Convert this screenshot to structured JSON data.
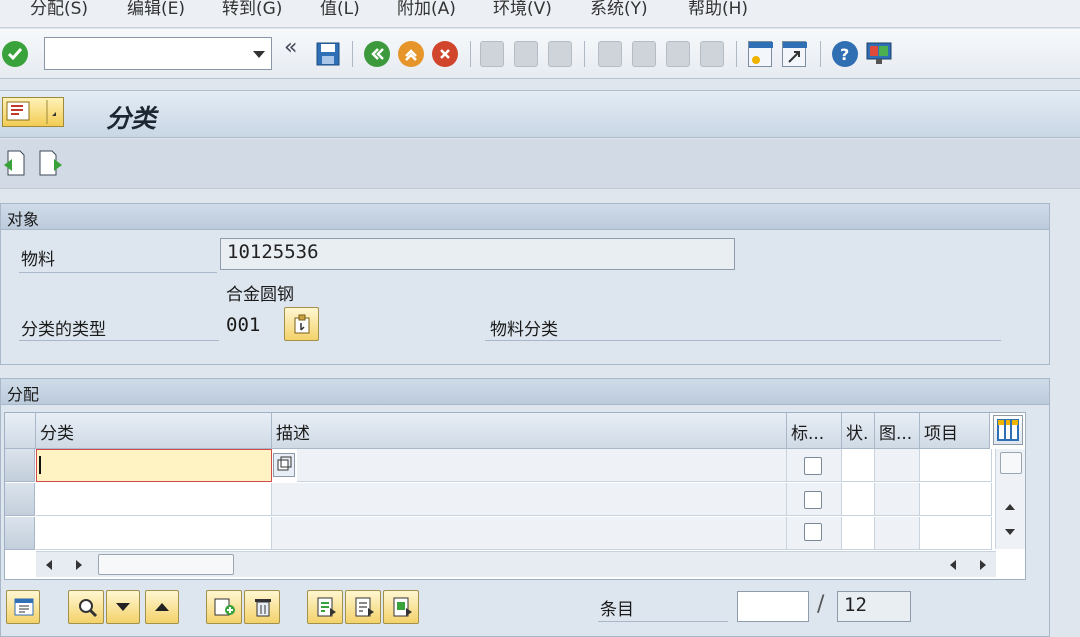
{
  "menu": {
    "items": [
      {
        "label": "分配(S)"
      },
      {
        "label": "编辑(E)"
      },
      {
        "label": "转到(G)"
      },
      {
        "label": "值(L)"
      },
      {
        "label": "附加(A)"
      },
      {
        "label": "环境(V)"
      },
      {
        "label": "系统(Y)"
      },
      {
        "label": "帮助(H)"
      }
    ]
  },
  "toolbar": {
    "command_value": "",
    "back_glyph": "«"
  },
  "title": {
    "text": "分类"
  },
  "object_group": {
    "title": "对象",
    "material_label": "物料",
    "material_value": "10125536",
    "material_desc": "合金圆钢",
    "class_type_label": "分类的类型",
    "class_type_value": "001",
    "class_type_desc": "物料分类"
  },
  "assignment_group": {
    "title": "分配",
    "columns": [
      "分类",
      "描述",
      "标...",
      "状.",
      "图...",
      "项目"
    ],
    "rows": [
      {
        "class": "",
        "desc": "",
        "std": false
      },
      {
        "class": "",
        "desc": "",
        "std": false
      },
      {
        "class": "",
        "desc": "",
        "std": false
      }
    ]
  },
  "footer": {
    "entries_label": "条目",
    "entries_current": "",
    "entries_separator": "/",
    "entries_total": "12"
  },
  "colors": {
    "accent_yellow": "#f4d26a",
    "background": "#dfe6ee",
    "cell_active": "#fff3c4"
  }
}
